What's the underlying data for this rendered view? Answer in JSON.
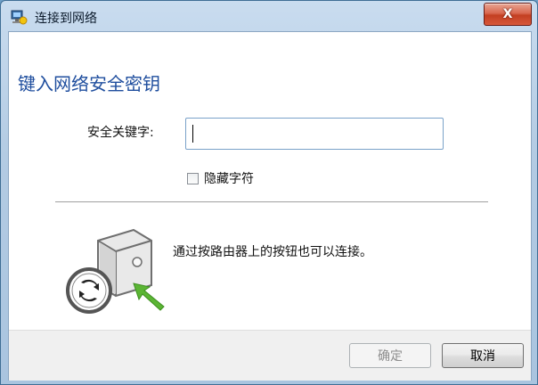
{
  "window": {
    "title": "连接到网络",
    "close_label": "X"
  },
  "dialog": {
    "heading": "键入网络安全密钥",
    "security_key_label": "安全关键字:",
    "security_key_value": "",
    "hide_characters_label": "隐藏字符",
    "hide_characters_checked": false,
    "wps_message": "通过按路由器上的按钮也可以连接。"
  },
  "buttons": {
    "ok_label": "确定",
    "ok_enabled": false,
    "cancel_label": "取消"
  },
  "icons": {
    "title": "network-icon",
    "router": "router-wps-icon"
  },
  "colors": {
    "heading": "#1f4e9e",
    "close_button": "#c33f22",
    "wps_arrow": "#5bb534"
  }
}
